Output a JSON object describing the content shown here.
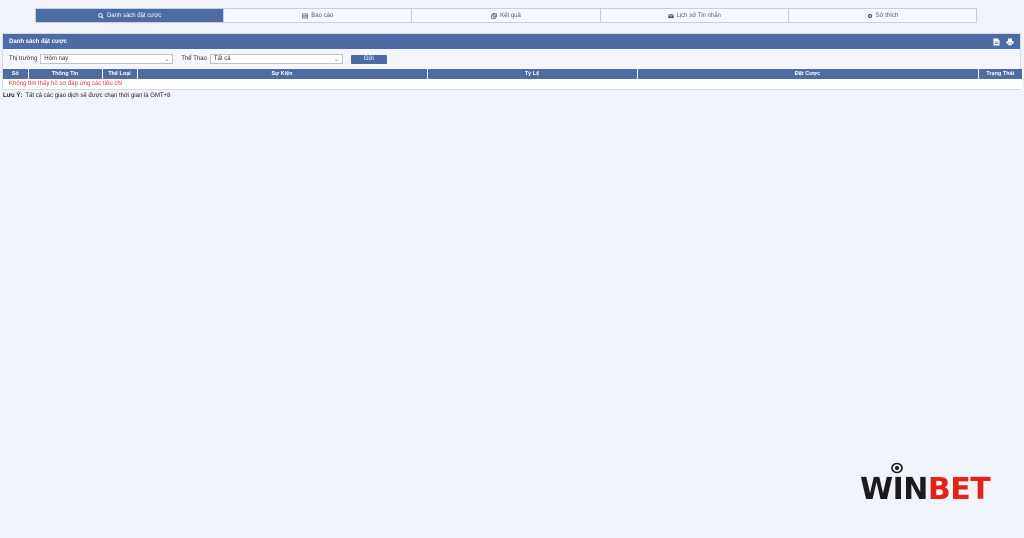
{
  "tabs": [
    {
      "label": "Danh sách đặt cược",
      "icon": "list-search-icon",
      "active": true
    },
    {
      "label": "Báo cáo",
      "icon": "report-icon",
      "active": false
    },
    {
      "label": "Kết quả",
      "icon": "results-icon",
      "active": false
    },
    {
      "label": "Lịch sử Tin nhắn",
      "icon": "envelope-icon",
      "active": false
    },
    {
      "label": "Sở thích",
      "icon": "gear-icon",
      "active": false
    }
  ],
  "panel": {
    "title": "Danh sách đặt cược",
    "icons": [
      "export-doc-icon",
      "print-icon"
    ]
  },
  "filters": {
    "market_label": "Thị trường",
    "market_value": "Hôm nay",
    "sport_label": "Thể Thao",
    "sport_value": "Tất cả",
    "submit_label": "Gửi"
  },
  "table": {
    "columns": [
      "Số",
      "Thông Tin",
      "Thể Loại",
      "Sự Kiện",
      "Tỷ Lệ",
      "Đặt Cược",
      "Trạng Thái"
    ],
    "empty_message": "Không tìm thấy hồ sơ đáp ứng các tiêu chí"
  },
  "note": {
    "label": "Lưu Ý:",
    "text": "Tất cả các giao dịch sẽ được chạn thời gian là GMT+8"
  },
  "logo": {
    "part1": "WIN",
    "part2": "BET"
  },
  "colors": {
    "accent": "#4d6ca6",
    "error": "#d23a2a",
    "logo_red": "#e2231a",
    "background": "#f0f3fa"
  }
}
